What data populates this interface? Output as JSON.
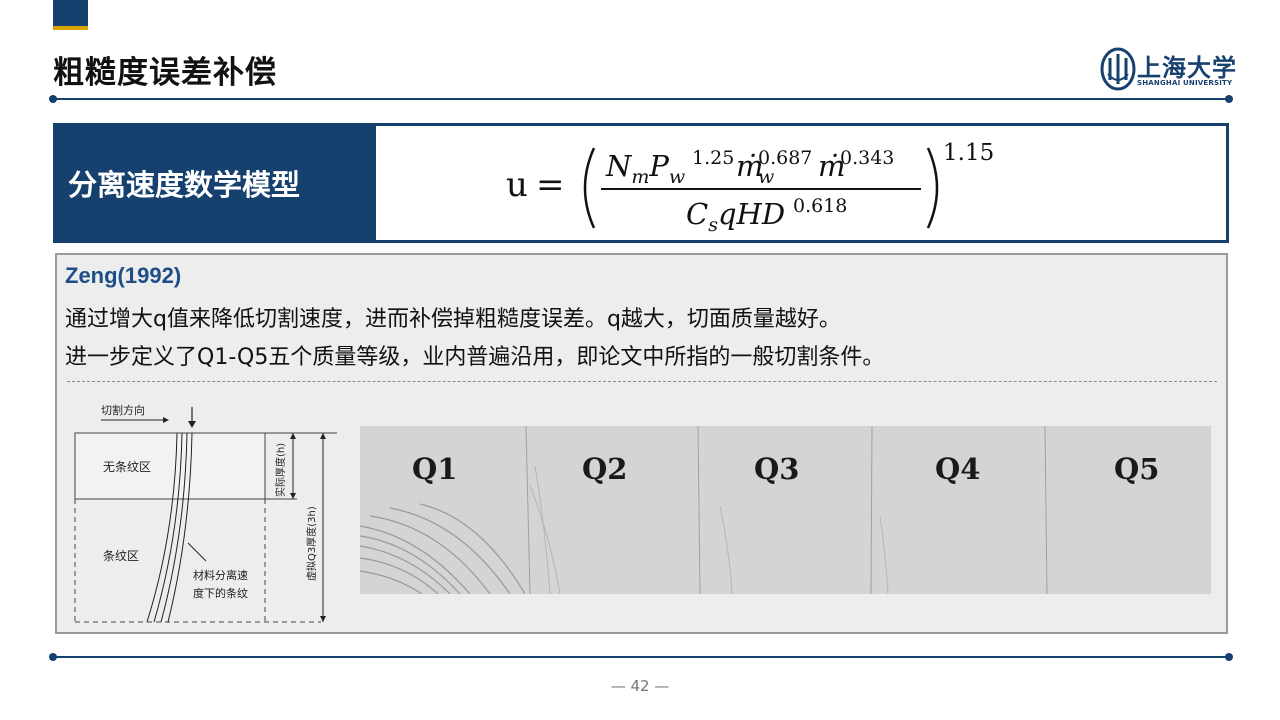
{
  "slide": {
    "title": "粗糙度误差补偿",
    "page_number": "42",
    "page_number_display": "— 42 —"
  },
  "logo": {
    "name": "上海大学",
    "subtitle": "SHANGHAI UNIVERSITY"
  },
  "model": {
    "label": "分离速度数学模型"
  },
  "content": {
    "reference": "Zeng(1992)",
    "line1": "通过增大q值来降低切割速度，进而补偿掉粗糙度误差。q越大，切面质量越好。",
    "line2": "进一步定义了Q1-Q5五个质量等级，业内普遍沿用，即论文中所指的一般切割条件。"
  },
  "diagram": {
    "cut_direction": "切割方向",
    "no_striation": "无条纹区",
    "striation": "条纹区",
    "actual_thickness": "实际厚度(h)",
    "virtual_thickness": "虚拟Q3厚度(3h)",
    "curve_label_1": "材料分离速",
    "curve_label_2": "度下的条纹"
  },
  "quality_grades": [
    "Q1",
    "Q2",
    "Q3",
    "Q4",
    "Q5"
  ],
  "colors": {
    "primary": "#16406e",
    "accent": "#d9a400",
    "reference": "#1d4f86"
  }
}
